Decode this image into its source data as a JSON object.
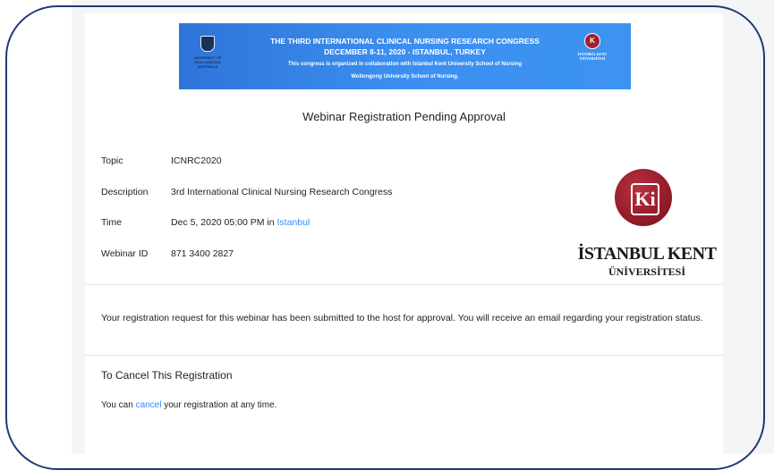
{
  "banner": {
    "line1": "THE THIRD INTERNATIONAL CLINICAL NURSING RESEARCH CONGRESS",
    "line2": "DECEMBER 8-11, 2020 - ISTANBUL, TURKEY",
    "line3": "This congress is organized in collaboration with Istanbul Kent University School of Nursing",
    "line4": "Wollongong University School of Nursing.",
    "left_logo_text": "UNIVERSITY OF WOLLONGONG AUSTRALIA",
    "right_logo_text": "İSTANBUL KENT ÜNİVERSİTESİ",
    "color": "#3b8ff0"
  },
  "page_title": "Webinar Registration Pending Approval",
  "details": {
    "topic_label": "Topic",
    "topic_value": "ICNRC2020",
    "description_label": "Description",
    "description_value": "3rd International Clinical Nursing Research Congress",
    "time_label": "Time",
    "time_value": "Dec 5, 2020 05:00 PM in ",
    "time_zone": "Istanbul",
    "webinar_id_label": "Webinar ID",
    "webinar_id_value": "871 3400 2827"
  },
  "logo": {
    "name": "İSTANBUL KENT",
    "sub": "ÜNİVERSİTESİ",
    "monogram": "Ki",
    "color": "#a0202e"
  },
  "notice": "Your registration request for this webinar has been submitted to the host for approval. You will receive an email regarding your registration status.",
  "cancel_section": {
    "heading": "To Cancel This Registration",
    "text_before": "You can ",
    "link": "cancel",
    "text_after": " your registration at any time."
  },
  "colors": {
    "link": "#2d8cff",
    "frame": "#1f3b73"
  }
}
